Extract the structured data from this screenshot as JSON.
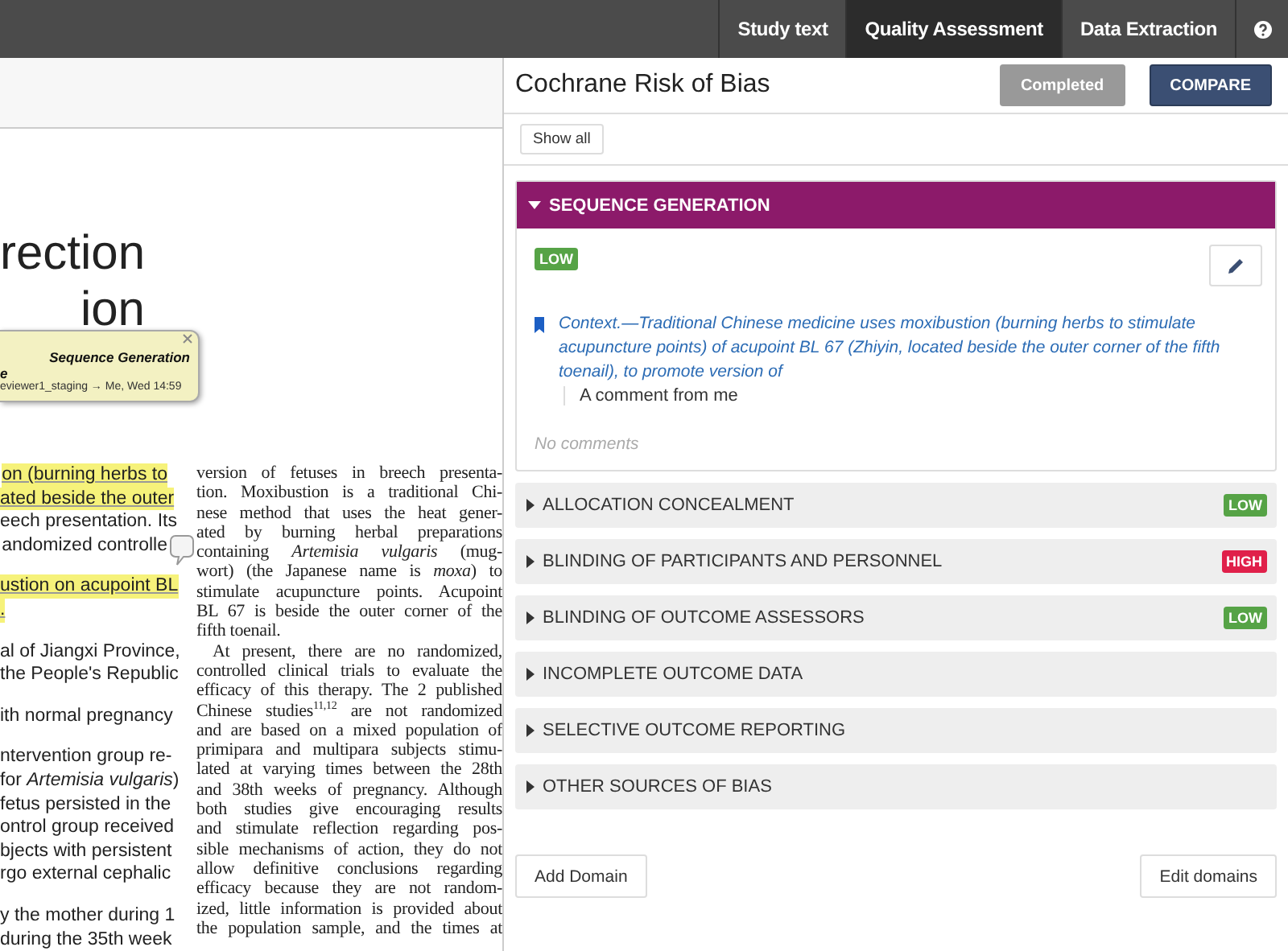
{
  "tabs": [
    {
      "label": "Study text",
      "selected": false
    },
    {
      "label": "Quality Assessment",
      "selected": true
    },
    {
      "label": "Data Extraction",
      "selected": false
    }
  ],
  "document": {
    "heading_lines": [
      "rection",
      "ion"
    ],
    "note": {
      "title": "Sequence Generation",
      "line_2": "e",
      "meta": "eviewer1_staging → Me, Wed 14:59"
    },
    "column_1": [
      {
        "text": "on (burning herbs to",
        "highlighted": true,
        "kind": "line"
      },
      {
        "text": "ated beside the outer",
        "highlighted": true,
        "kind": "line"
      },
      {
        "text": "eech presentation. Its",
        "highlighted": false,
        "kind": "line"
      },
      {
        "text": "andomized controlle",
        "highlighted": false,
        "kind": "line"
      },
      {
        "text": "ustion on acupoint BL",
        "highlighted": true,
        "kind": "paragraph_start"
      },
      {
        "text": ".",
        "highlighted": true,
        "kind": "paragraph_end"
      },
      {
        "text": "al of Jiangxi Province,",
        "highlighted": false,
        "kind": "paragraph_start"
      },
      {
        "text": "the People's Republic",
        "highlighted": false,
        "kind": "line"
      },
      {
        "text": "ith normal pregnancy",
        "highlighted": false,
        "kind": "paragraph_start"
      },
      {
        "text": "ntervention group re-",
        "highlighted": false,
        "kind": "paragraph_start"
      },
      {
        "text": "for *Artemisia vulgaris*)",
        "highlighted": false,
        "kind": "line"
      },
      {
        "text": "fetus persisted in the",
        "highlighted": false,
        "kind": "line"
      },
      {
        "text": "ontrol group received",
        "highlighted": false,
        "kind": "line"
      },
      {
        "text": "bjects with persistent",
        "highlighted": false,
        "kind": "line"
      },
      {
        "text": "rgo external cephalic",
        "highlighted": false,
        "kind": "line"
      },
      {
        "text": "y the mother during 1",
        "highlighted": false,
        "kind": "paragraph_start"
      },
      {
        "text": "during the 35th week",
        "highlighted": false,
        "kind": "line"
      }
    ],
    "column_2": [
      {
        "text": "version of fetuses in breech presenta-",
        "kind": "line"
      },
      {
        "text": "tion. Moxibustion is a traditional Chi-",
        "kind": "line"
      },
      {
        "text": "nese method that uses the heat gener-",
        "kind": "line"
      },
      {
        "text": "ated by burning herbal preparations",
        "kind": "line"
      },
      {
        "text": "containing *Artemisia vulgaris* (mug-",
        "kind": "line"
      },
      {
        "text": "wort) (the Japanese name is *moxa*) to",
        "kind": "line"
      },
      {
        "text": "stimulate acupuncture points. Acupoint",
        "kind": "line"
      },
      {
        "text": "BL 67 is beside the outer corner of the",
        "kind": "line"
      },
      {
        "text": "fifth toenail.",
        "kind": "paragraph_end"
      },
      {
        "text": "At present, there are no randomized,",
        "kind": "paragraph_start"
      },
      {
        "text": "controlled clinical trials to evaluate the",
        "kind": "line"
      },
      {
        "text": "efficacy of this therapy. The 2 published",
        "kind": "line"
      },
      {
        "text": "Chinese studies$^{11,12}$ are not randomized",
        "kind": "line"
      },
      {
        "text": "and are based on a mixed population of",
        "kind": "line"
      },
      {
        "text": "primipara and multipara subjects stimu-",
        "kind": "line"
      },
      {
        "text": "lated at varying times between the 28th",
        "kind": "line"
      },
      {
        "text": "and 38th weeks of pregnancy. Although",
        "kind": "line"
      },
      {
        "text": "both studies give encouraging results",
        "kind": "line"
      },
      {
        "text": "and stimulate reflection regarding pos-",
        "kind": "line"
      },
      {
        "text": "sible mechanisms of action, they do not",
        "kind": "line"
      },
      {
        "text": "allow definitive conclusions regarding",
        "kind": "line"
      },
      {
        "text": "efficacy because they are not random-",
        "kind": "line"
      },
      {
        "text": "ized, little information is provided about",
        "kind": "line"
      },
      {
        "text": "the population sample, and the times at",
        "kind": "line"
      }
    ]
  },
  "panel": {
    "title": "Cochrane Risk of Bias",
    "status_button": {
      "label": "Completed",
      "disabled": true
    },
    "compare_button": {
      "label": "COMPARE"
    },
    "show_all_button": {
      "label": "Show all"
    },
    "domains": [
      {
        "title": "SEQUENCE GENERATION",
        "expanded": true,
        "rating": {
          "label": "LOW",
          "kind": "low"
        },
        "quote": "*Context.*—Traditional Chinese medicine uses moxibustion (burning herbs to stimulate acupuncture points) of acupoint BL 67 (Zhiyin, located beside the outer corner of the fifth toenail), to promote version of",
        "comment": "A comment from me",
        "no_comments": "No comments"
      },
      {
        "title": "ALLOCATION CONCEALMENT",
        "expanded": false,
        "rating": {
          "label": "LOW",
          "kind": "low"
        }
      },
      {
        "title": "BLINDING OF PARTICIPANTS AND PERSONNEL",
        "expanded": false,
        "rating": {
          "label": "HIGH",
          "kind": "high"
        }
      },
      {
        "title": "BLINDING OF OUTCOME ASSESSORS",
        "expanded": false,
        "rating": {
          "label": "LOW",
          "kind": "low"
        }
      },
      {
        "title": "INCOMPLETE OUTCOME DATA",
        "expanded": false
      },
      {
        "title": "SELECTIVE OUTCOME REPORTING",
        "expanded": false
      },
      {
        "title": "OTHER SOURCES OF BIAS",
        "expanded": false
      }
    ],
    "add_button": {
      "label": "Add Domain"
    },
    "edit_button": {
      "label": "Edit domains"
    }
  }
}
